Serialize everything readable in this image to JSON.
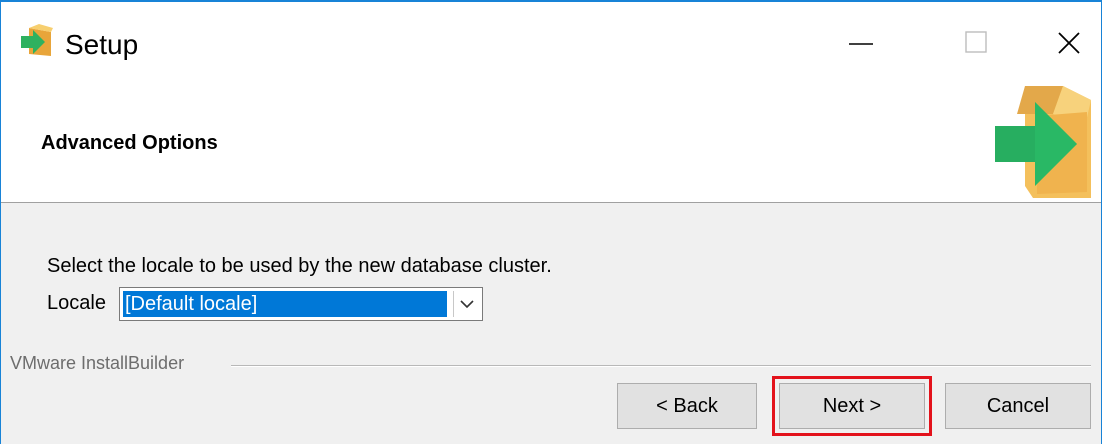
{
  "window": {
    "title": "Setup",
    "icon": "setup-package-arrow-icon",
    "controls": [
      "minimize-icon",
      "maximize-icon",
      "close-icon"
    ]
  },
  "header": {
    "title": "Advanced Options",
    "logo": "installer-box-arrow-icon"
  },
  "content": {
    "prompt": "Select the locale to be used by the new database cluster.",
    "locale_label": "Locale",
    "locale_selected": "[Default locale]"
  },
  "footer": {
    "brand": "VMware InstallBuilder",
    "back_label": "< Back",
    "next_label": "Next >",
    "cancel_label": "Cancel"
  },
  "colors": {
    "accent": "#0078d7",
    "window_border": "#1883d7",
    "highlight": "#e3121b",
    "box": "#f4c05c",
    "arrow": "#27ae60"
  }
}
